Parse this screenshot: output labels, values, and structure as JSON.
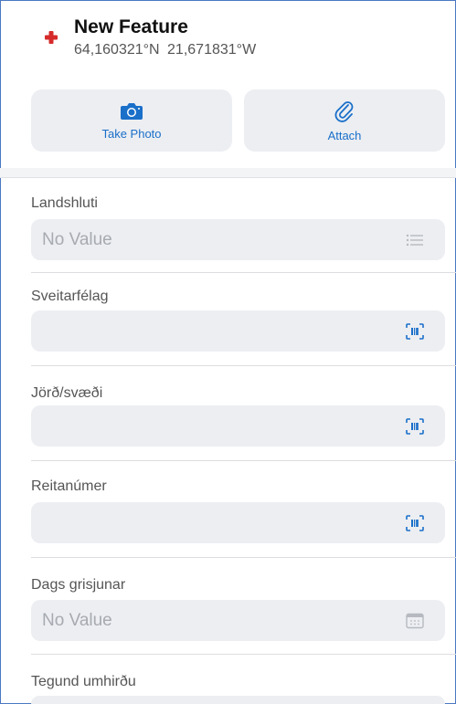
{
  "feature": {
    "title": "New Feature",
    "coordinates": "64,160321°N 21,671831°W",
    "icon": "red-cross-icon"
  },
  "actions": {
    "take_photo_label": "Take Photo",
    "attach_label": "Attach"
  },
  "fields": [
    {
      "label": "Landshluti",
      "value": "No Value",
      "icon": "list-icon"
    },
    {
      "label": "Sveitarfélag",
      "value": "",
      "icon": "barcode-scan-icon"
    },
    {
      "label": "Jörð/svæði",
      "value": "",
      "icon": "barcode-scan-icon"
    },
    {
      "label": "Reitanúmer",
      "value": "",
      "icon": "barcode-scan-icon"
    },
    {
      "label": "Dags grisjunar",
      "value": "No Value",
      "icon": "calendar-icon"
    },
    {
      "label": "Tegund umhirðu",
      "value": "",
      "icon": ""
    }
  ],
  "colors": {
    "accent": "#1a6fc9",
    "feature_icon": "#d62b2b",
    "field_background": "#eceef2",
    "frame_border": "#4a78c2"
  }
}
